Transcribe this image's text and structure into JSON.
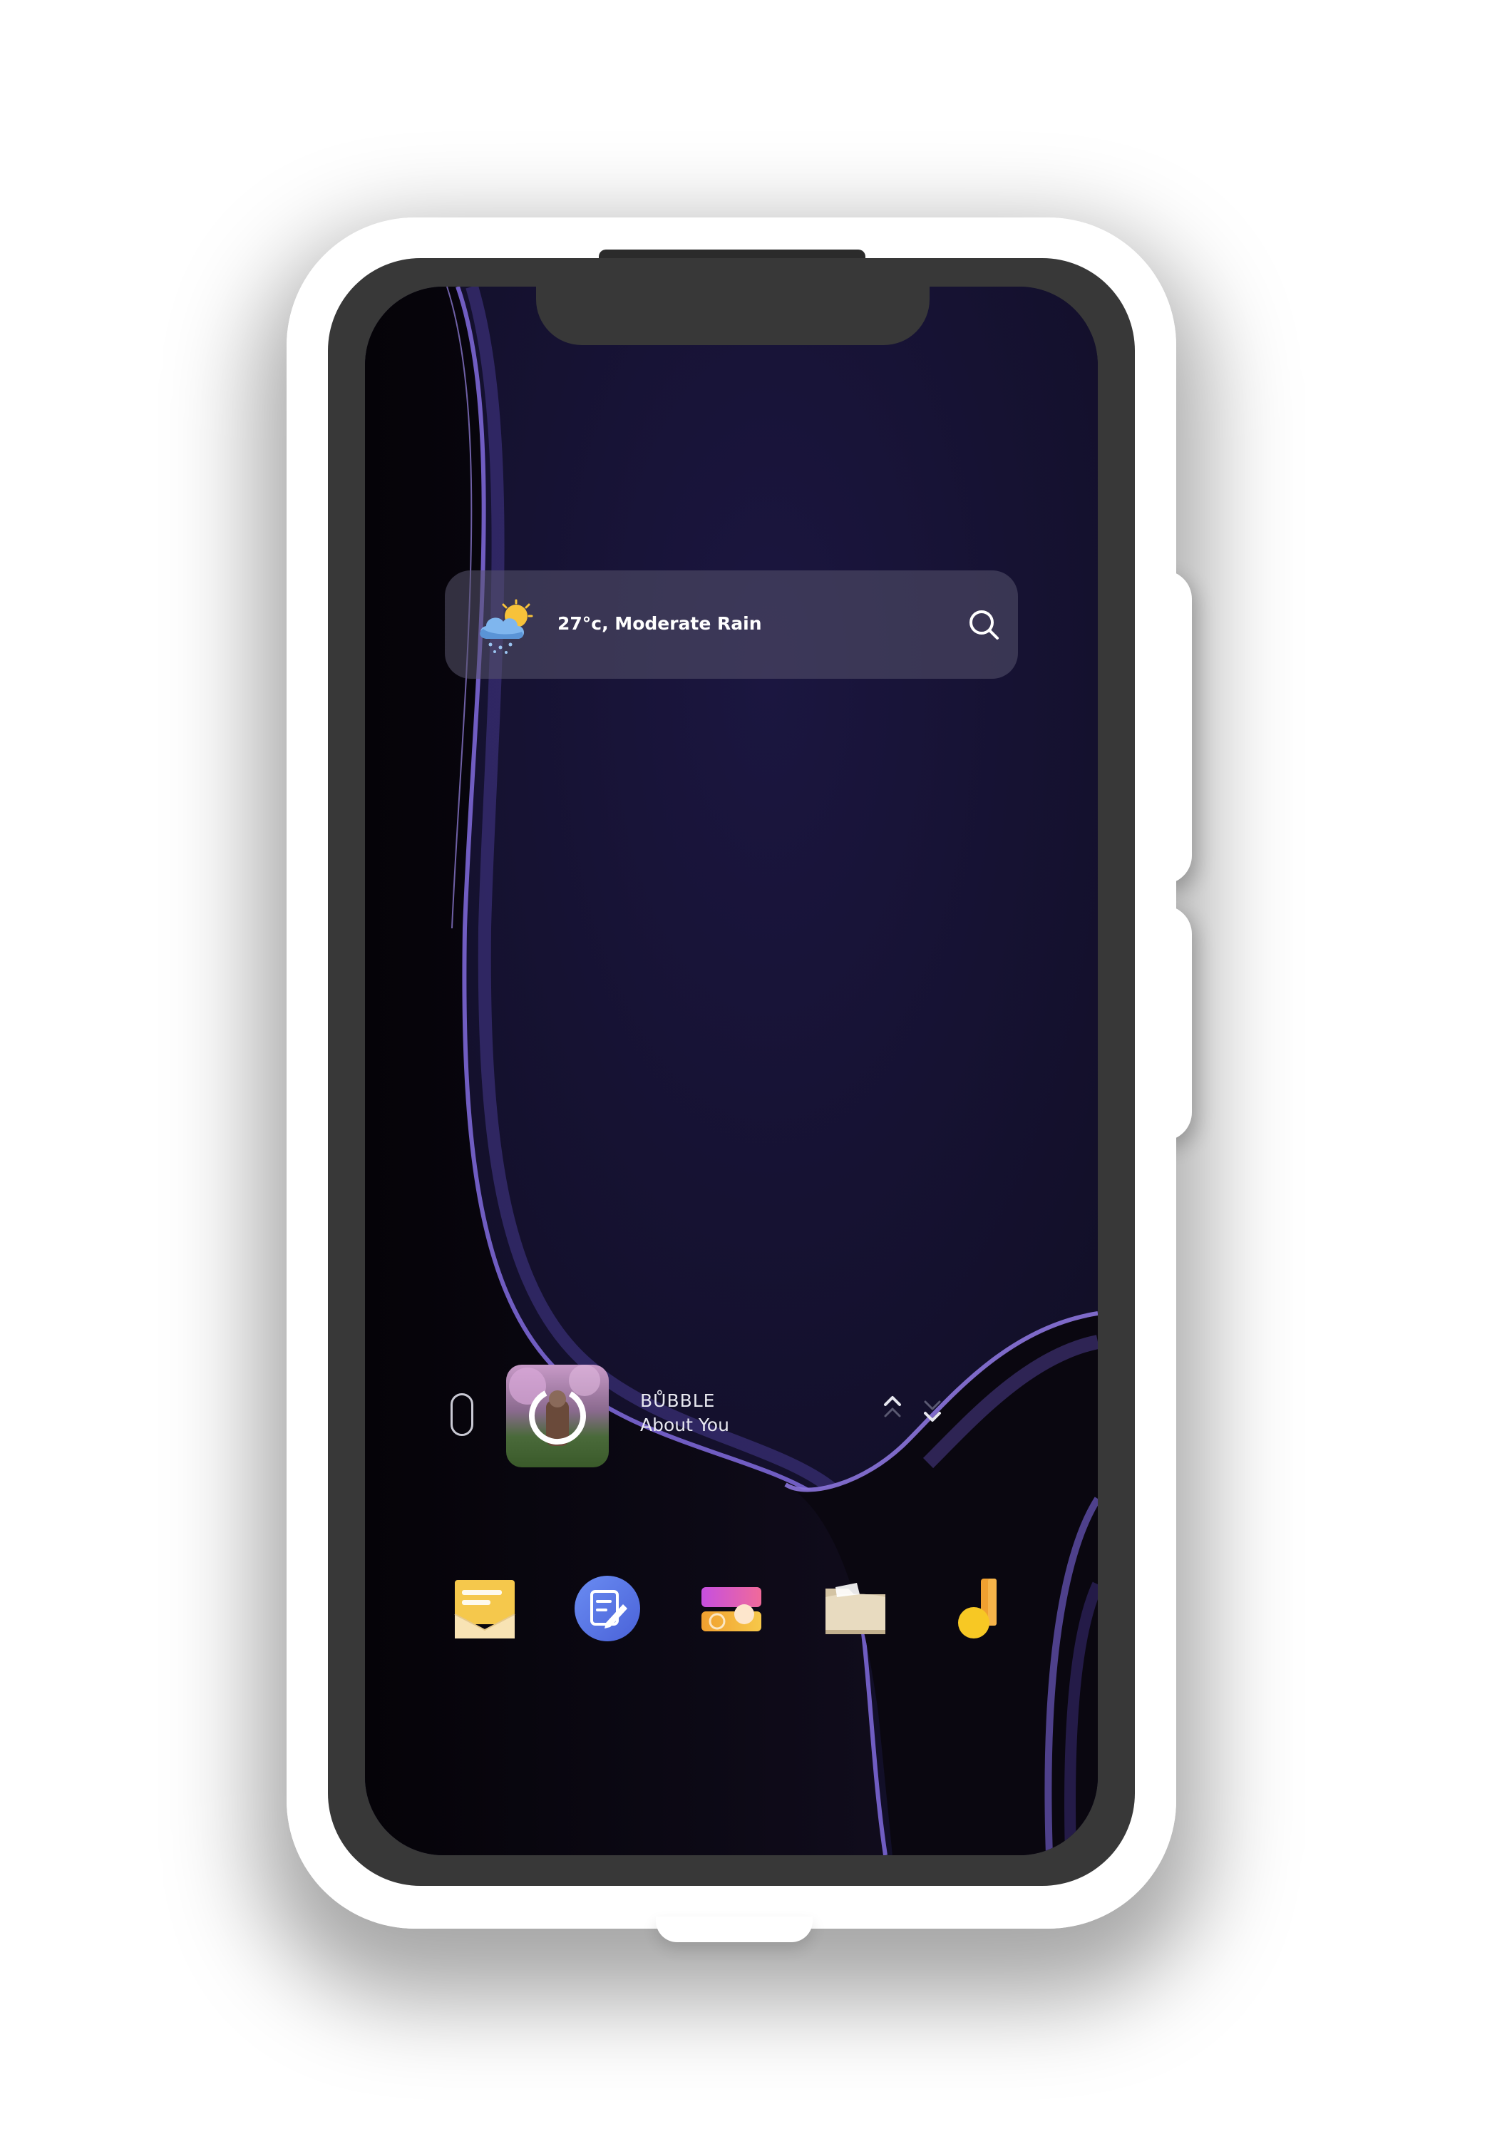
{
  "weather": {
    "text": "27°c, Moderate Rain",
    "icon": "cloud-sun-rain-icon"
  },
  "search": {
    "icon": "search-icon"
  },
  "music": {
    "artist": "BŮBBLE",
    "title": "About You",
    "album_art": "album-art",
    "prev_icon": "chevron-up-icon",
    "next_icon": "chevron-down-icon"
  },
  "dock": {
    "apps": [
      {
        "icon": "messages-icon"
      },
      {
        "icon": "notes-icon"
      },
      {
        "icon": "widgets-app-icon"
      },
      {
        "icon": "files-icon"
      },
      {
        "icon": "music-app-icon"
      }
    ]
  },
  "colors": {
    "wallpaper_base": "#13102a",
    "wallpaper_accent": "#5a4aa8",
    "bezel": "#383838",
    "case": "#ffffff"
  }
}
